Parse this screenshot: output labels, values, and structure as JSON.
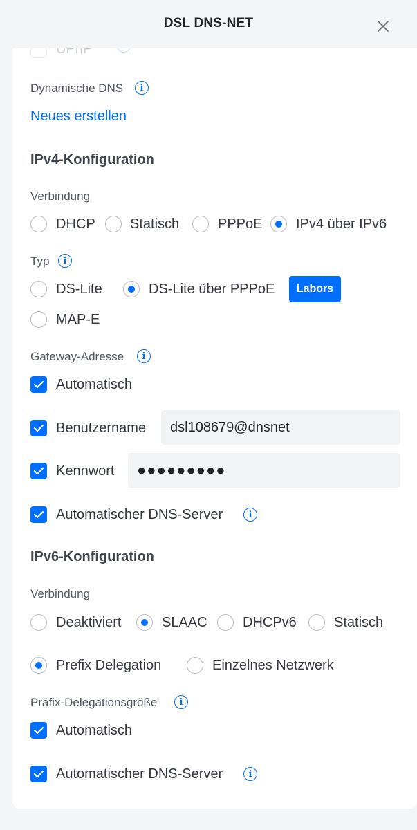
{
  "window": {
    "title": "DSL DNS-NET"
  },
  "top_partial": {
    "label": "UPnP"
  },
  "dynamic_dns": {
    "label": "Dynamische DNS",
    "create_link": "Neues erstellen"
  },
  "ipv4": {
    "section_title": "IPv4-Konfiguration",
    "connection_label": "Verbindung",
    "connection_options": [
      "DHCP",
      "Statisch",
      "PPPoE",
      "IPv4 über IPv6"
    ],
    "connection_selected": "IPv4 über IPv6",
    "type_label": "Typ",
    "type_options": [
      "DS-Lite",
      "DS-Lite über PPPoE",
      "MAP-E"
    ],
    "type_selected": "DS-Lite über PPPoE",
    "labs_badge": "Labors",
    "gateway_label": "Gateway-Adresse",
    "gateway_auto_label": "Automatisch",
    "username_label": "Benutzername",
    "username_value": "dsl108679@dnsnet",
    "password_label": "Kennwort",
    "password_mask": "●●●●●●●●●",
    "auto_dns_label": "Automatischer DNS-Server"
  },
  "ipv6": {
    "section_title": "IPv6-Konfiguration",
    "connection_label": "Verbindung",
    "connection_options": [
      "Deaktiviert",
      "SLAAC",
      "DHCPv6",
      "Statisch"
    ],
    "connection_selected": "SLAAC",
    "mode_options": [
      "Prefix Delegation",
      "Einzelnes Netzwerk"
    ],
    "mode_selected": "Prefix Delegation",
    "prefix_size_label": "Präfix-Delegationsgröße",
    "prefix_auto_label": "Automatisch",
    "auto_dns_label": "Automatischer DNS-Server"
  },
  "colors": {
    "accent": "#006fff",
    "background": "#f4f5f6",
    "panel": "#ffffff"
  },
  "icons": {
    "close": "close-icon",
    "info": "info-icon",
    "check": "checkmark-icon"
  }
}
